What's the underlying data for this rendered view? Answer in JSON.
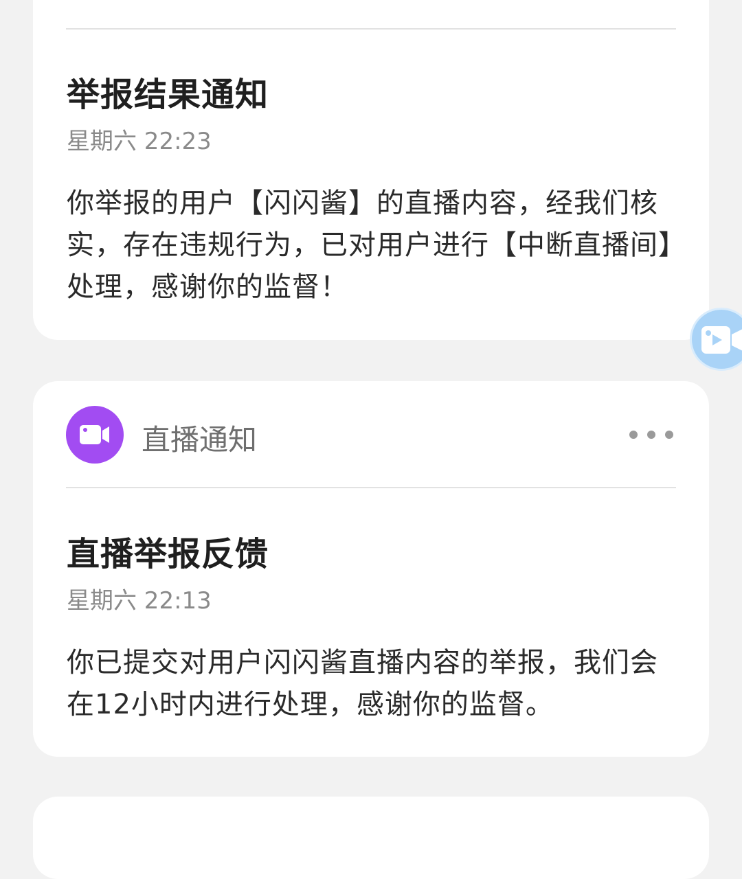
{
  "cards": [
    {
      "title": "举报结果通知",
      "time": "星期六 22:23",
      "body": "你举报的用户【闪闪酱】的直播内容，经我们核实，存在违规行为，已对用户进行【中断直播间】处理，感谢你的监督！"
    },
    {
      "header": {
        "label": "直播通知",
        "icon": "video-camera-icon",
        "more_icon": "more-options-icon"
      },
      "title": "直播举报反馈",
      "time": "星期六 22:13",
      "body": "你已提交对用户闪闪酱直播内容的举报，我们会在12小时内进行处理，感谢你的监督。"
    }
  ],
  "floating_button": {
    "icon": "video-camera-icon"
  },
  "colors": {
    "accent_purple": "#a24cf2",
    "background": "#f2f2f2",
    "floating_blue": "#a9d3f7"
  }
}
